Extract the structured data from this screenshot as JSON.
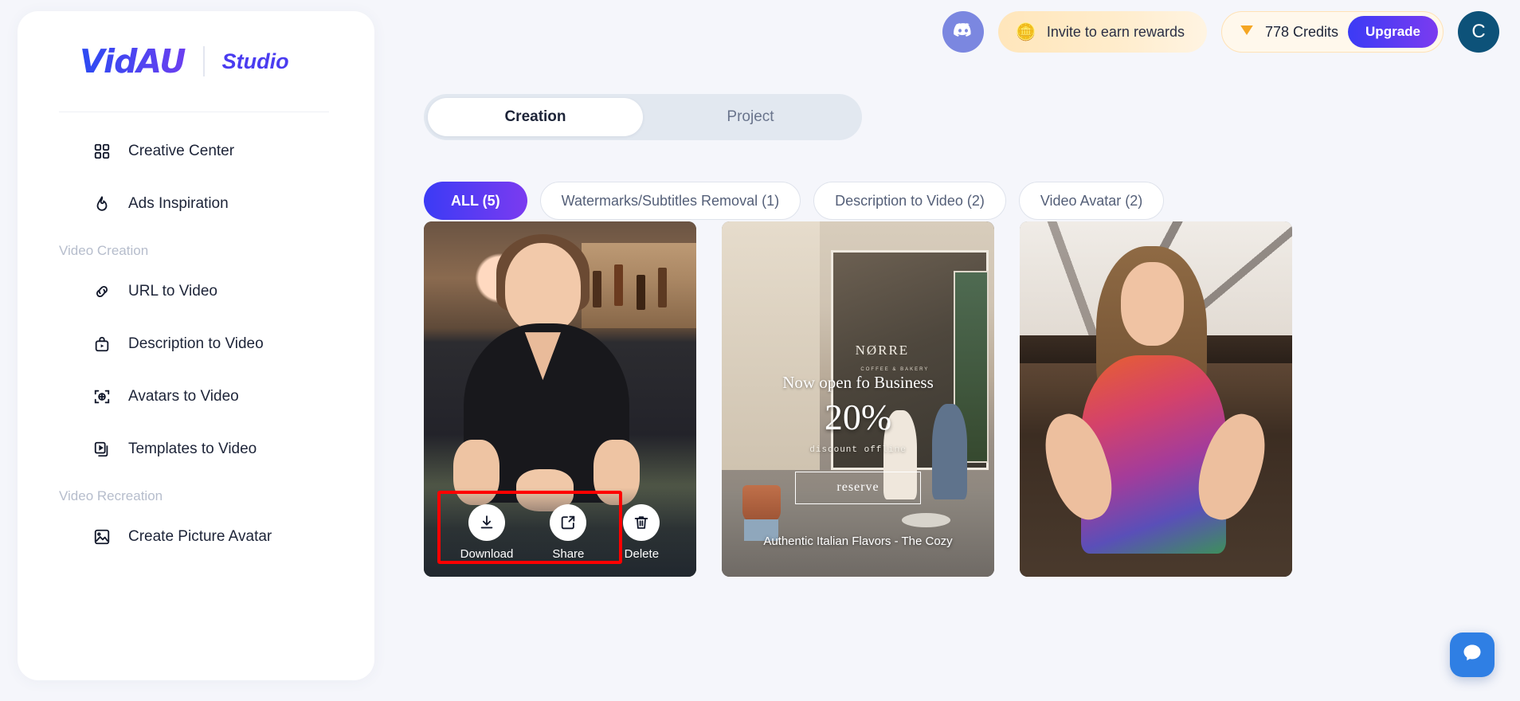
{
  "brand": {
    "logo": "VidAU",
    "studio": "Studio"
  },
  "sidebar": {
    "items": [
      {
        "label": "Creative Center",
        "icon": "grid-icon"
      },
      {
        "label": "Ads Inspiration",
        "icon": "flame-icon"
      }
    ],
    "groups": [
      {
        "title": "Video Creation",
        "items": [
          {
            "label": "URL to Video",
            "icon": "link-icon"
          },
          {
            "label": "Description to Video",
            "icon": "video-tag-icon"
          },
          {
            "label": "Avatars to Video",
            "icon": "target-avatar-icon"
          },
          {
            "label": "Templates to Video",
            "icon": "templates-icon"
          }
        ]
      },
      {
        "title": "Video Recreation",
        "items": [
          {
            "label": "Create Picture Avatar",
            "icon": "image-icon"
          }
        ]
      }
    ]
  },
  "header": {
    "discord_label": "discord-icon",
    "invite_label": "Invite to earn rewards",
    "invite_icon": "coins-icon",
    "credits_value": "778 Credits",
    "credits_icon": "diamond-icon",
    "upgrade_label": "Upgrade",
    "avatar_initial": "C"
  },
  "tabs": [
    {
      "label": "Creation",
      "active": true
    },
    {
      "label": "Project",
      "active": false
    }
  ],
  "filters": [
    {
      "label": "ALL (5)",
      "active": true
    },
    {
      "label": "Watermarks/Subtitles Removal (1)",
      "active": false
    },
    {
      "label": "Description to Video (2)",
      "active": false
    },
    {
      "label": "Video Avatar (2)",
      "active": false
    }
  ],
  "cards": [
    {
      "kind": "bar-scene",
      "actions": [
        {
          "label": "Download",
          "icon": "download-icon"
        },
        {
          "label": "Share",
          "icon": "share-icon"
        },
        {
          "label": "Delete",
          "icon": "trash-icon"
        }
      ]
    },
    {
      "kind": "storefront-ad",
      "overlay": {
        "brand": "NØRRE",
        "brand_sub": "COFFEE & BAKERY",
        "headline": "Now open fo Business",
        "percent": "20%",
        "subtext": "discount offline",
        "button": "reserve",
        "footer": "Authentic Italian Flavors - The Cozy"
      }
    },
    {
      "kind": "kitchen-scene"
    }
  ],
  "colors": {
    "accent_start": "#3b3bf5",
    "accent_end": "#7b3bf0",
    "invite_bg": "#ffe6bb",
    "credits_border": "#ffe2b6",
    "avatar_bg": "#0d5279",
    "annotation_red": "#ff0000",
    "page_bg": "#f5f6fb"
  },
  "chat": {
    "icon": "chat-bubble-icon"
  }
}
